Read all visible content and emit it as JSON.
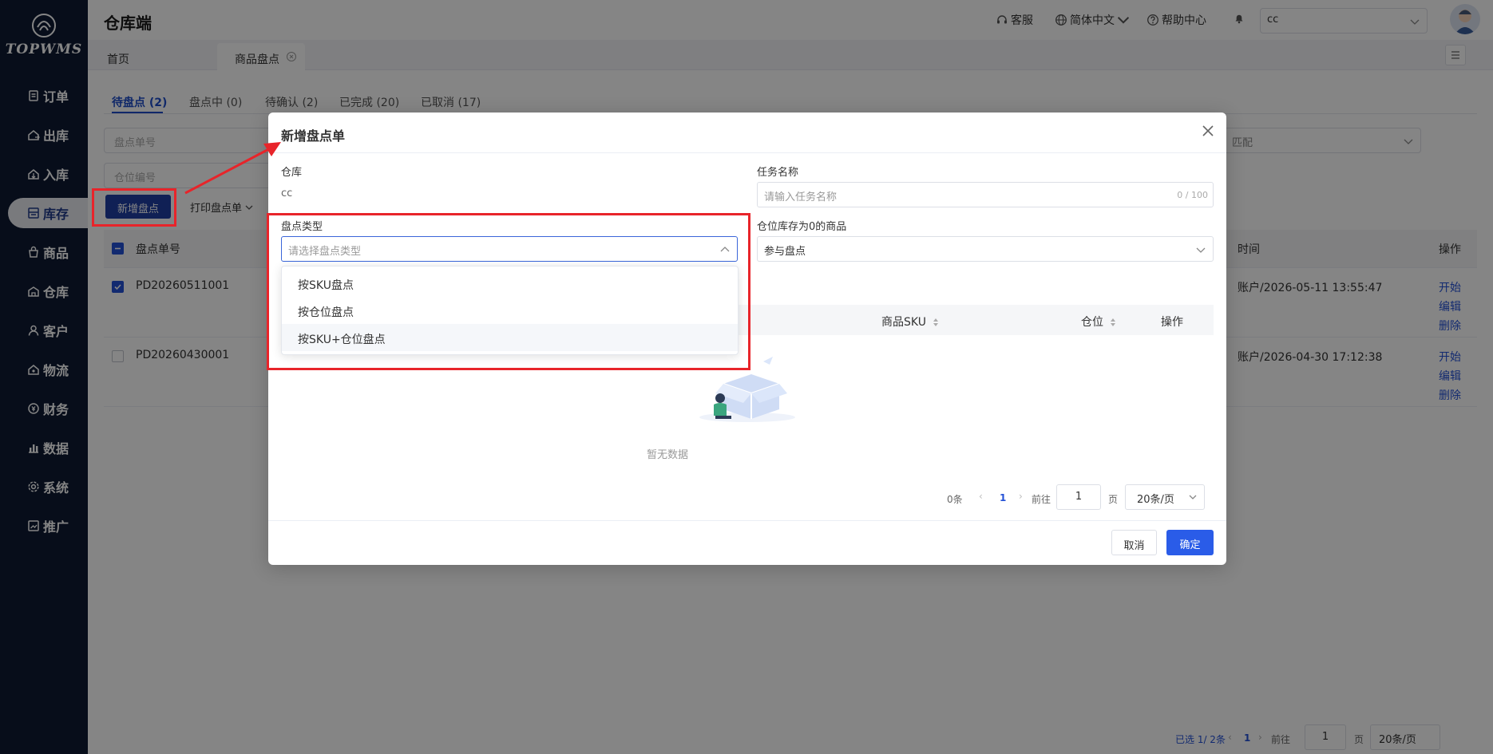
{
  "brand": {
    "name": "TOPWMS"
  },
  "sidebar": {
    "items": [
      {
        "label": "订单",
        "icon": "order-icon"
      },
      {
        "label": "出库",
        "icon": "outbound-icon"
      },
      {
        "label": "入库",
        "icon": "inbound-icon"
      },
      {
        "label": "库存",
        "icon": "inventory-icon",
        "active": true
      },
      {
        "label": "商品",
        "icon": "goods-icon"
      },
      {
        "label": "仓库",
        "icon": "warehouse-icon"
      },
      {
        "label": "客户",
        "icon": "customer-icon"
      },
      {
        "label": "物流",
        "icon": "logistics-icon"
      },
      {
        "label": "财务",
        "icon": "finance-icon"
      },
      {
        "label": "数据",
        "icon": "data-icon"
      },
      {
        "label": "系统",
        "icon": "system-icon"
      },
      {
        "label": "推广",
        "icon": "promotion-icon"
      }
    ]
  },
  "header": {
    "title": "仓库端",
    "service": "客服",
    "language": "简体中文",
    "help": "帮助中心",
    "warehouse": "cc"
  },
  "tabs": {
    "home": "首页",
    "current": "商品盘点"
  },
  "status_tabs": [
    {
      "label": "待盘点 (2)",
      "active": true
    },
    {
      "label": "盘点中 (0)"
    },
    {
      "label": "待确认 (2)"
    },
    {
      "label": "已完成 (20)"
    },
    {
      "label": "已取消 (17)"
    }
  ],
  "filters": {
    "order_no_placeholder": "盘点单号",
    "location_placeholder": "仓位编号",
    "match_placeholder": "匹配"
  },
  "toolbar": {
    "new_label": "新增盘点",
    "print_label": "打印盘点单"
  },
  "table": {
    "headers": {
      "order_no": "盘点单号",
      "time": "时间",
      "ops": "操作"
    },
    "rows": [
      {
        "order_no": "PD20260511001",
        "time": "账户/2026-05-11 13:55:47",
        "checked": true
      },
      {
        "order_no": "PD20260430001",
        "time": "账户/2026-04-30 17:12:38",
        "checked": false
      }
    ],
    "ops": {
      "start": "开始",
      "edit": "编辑",
      "delete": "删除"
    }
  },
  "bottom_pager": {
    "selected": "已选 1/ 2条",
    "page": "1",
    "goto": "前往",
    "page_input": "1",
    "page_unit": "页",
    "size": "20条/页"
  },
  "dialog": {
    "title": "新增盘点单",
    "warehouse_label": "仓库",
    "warehouse_value": "cc",
    "task_name_label": "任务名称",
    "task_name_placeholder": "请输入任务名称",
    "task_name_counter": "0 / 100",
    "type_label": "盘点类型",
    "type_placeholder": "请选择盘点类型",
    "type_options": [
      "按SKU盘点",
      "按仓位盘点",
      "按SKU+仓位盘点"
    ],
    "zero_stock_label": "仓位库存为0的商品",
    "zero_stock_value": "参与盘点",
    "grid_headers": {
      "sku": "商品SKU",
      "location": "仓位",
      "ops": "操作"
    },
    "empty_text": "暂无数据",
    "pager": {
      "total": "0条",
      "page": "1",
      "goto": "前往",
      "page_input": "1",
      "page_unit": "页",
      "size": "20条/页"
    },
    "cancel_label": "取消",
    "confirm_label": "确定"
  },
  "colors": {
    "accent": "#2451d6",
    "sidebar": "#0e1a33",
    "annotation": "#e8242a"
  }
}
